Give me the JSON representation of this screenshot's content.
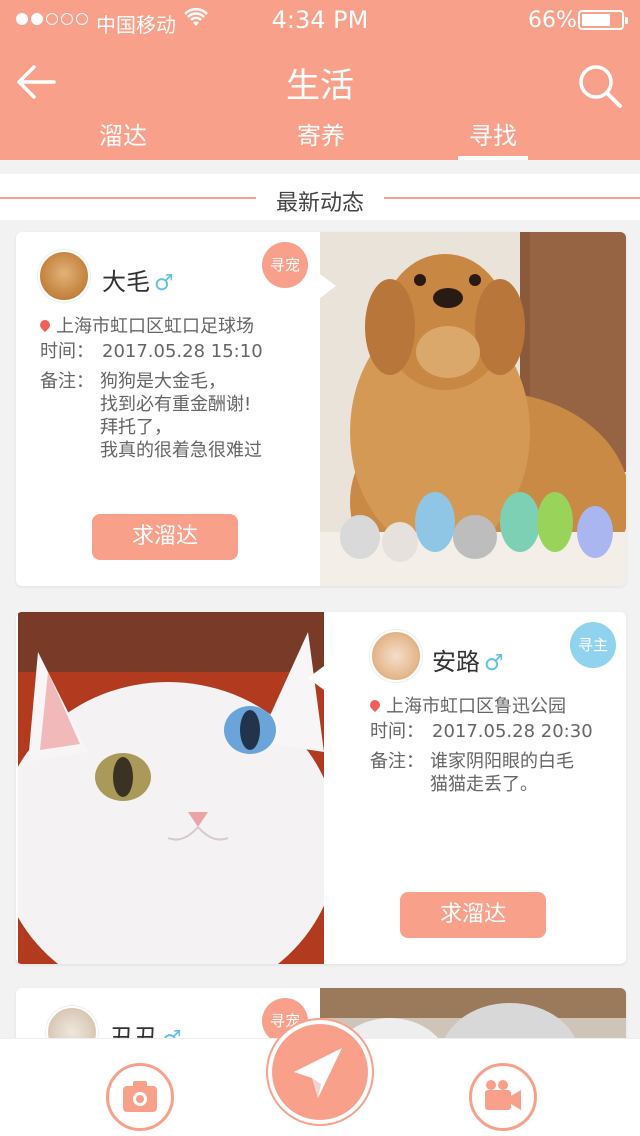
{
  "status_bar": {
    "carrier": "中国移动",
    "time": "4:34 PM",
    "battery": "66%",
    "battery_level": 0.66
  },
  "header": {
    "title": "生活",
    "tabs": [
      {
        "label": "溜达",
        "active": false
      },
      {
        "label": "寄养",
        "active": false
      },
      {
        "label": "寻找",
        "active": true
      }
    ]
  },
  "section": {
    "label": "最新动态"
  },
  "posts": [
    {
      "name": "大毛",
      "gender": "♂",
      "badge": "寻宠",
      "location": "上海市虹口区虹口足球场",
      "time_label": "时间：",
      "time": "2017.05.28  15:10",
      "note_label": "备注：",
      "note_lines": [
        "狗狗是大金毛，",
        "找到必有重金酬谢!",
        "拜托了，",
        "我真的很着急很难过"
      ],
      "button": "求溜达"
    },
    {
      "name": "安路",
      "gender": "♂",
      "badge": "寻主",
      "location": "上海市虹口区鲁迅公园",
      "time_label": "时间：",
      "time": "2017.05.28 20:30",
      "note_label": "备注：",
      "note_lines": [
        "谁家阴阳眼的白毛",
        "猫猫走丢了。"
      ],
      "button": "求溜达"
    },
    {
      "name": "丑丑",
      "gender": "♂",
      "badge": "寻宠"
    }
  ],
  "colors": {
    "accent": "#f9a08a",
    "gender": "#5fc3e4",
    "badge_blue": "#8fd3ef",
    "pin": "#f0605a"
  }
}
